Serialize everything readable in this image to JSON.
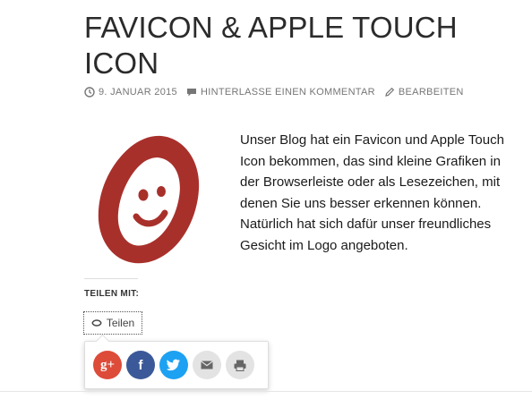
{
  "post": {
    "title": "FAVICON & APPLE TOUCH ICON",
    "meta": {
      "date": "9. JANUAR 2015",
      "comment": "HINTERLASSE EINEN KOMMENTAR",
      "edit": "BEARBEITEN"
    },
    "body": "Unser Blog hat ein Favicon und Apple Touch Icon bekommen, das sind kleine Grafiken in der Browserleiste oder als Le­sezeichen, mit denen Sie uns besser erken­nen können. Natürlich hat sich dafür unser freundliches Gesicht im Logo angeboten."
  },
  "share": {
    "heading": "TEILEN MIT:",
    "button_label": "Teilen",
    "services": [
      {
        "name": "google-plus",
        "glyph": "g+",
        "color": "#dd4b39"
      },
      {
        "name": "facebook",
        "glyph": "f",
        "color": "#3b5998"
      },
      {
        "name": "twitter",
        "icon": "twitter-bird-icon",
        "color": "#1da1f2"
      },
      {
        "name": "email",
        "icon": "envelope-icon",
        "color": "#e3e3e3"
      },
      {
        "name": "print",
        "icon": "printer-icon",
        "color": "#e3e3e3"
      }
    ]
  },
  "colors": {
    "logo_red": "#a8302b",
    "meta_grey": "#767676"
  }
}
